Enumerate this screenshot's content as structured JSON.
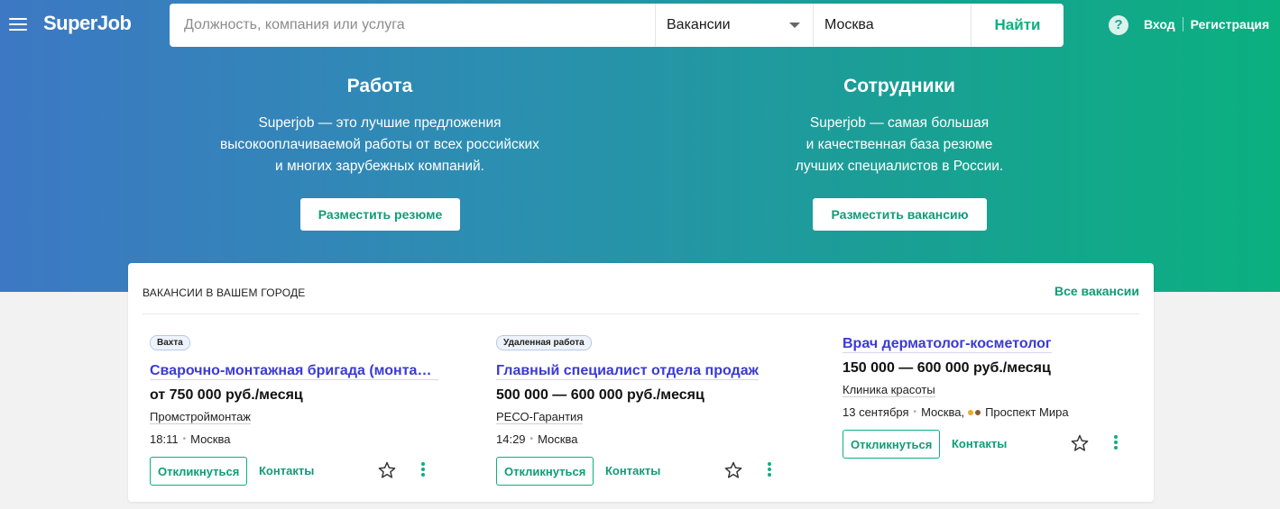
{
  "header": {
    "logo": "SuperJob",
    "search_placeholder": "Должность, компания или услуга",
    "type_select": "Вакансии",
    "city": "Москва",
    "find_button": "Найти",
    "help_icon": "?",
    "login": "Вход",
    "register": "Регистрация"
  },
  "hero": {
    "work": {
      "title": "Работа",
      "line1": "Superjob — это лучшие предложения",
      "line2": "высокооплачиваемой работы от всех российских",
      "line3": "и многих зарубежных компаний.",
      "button": "Разместить резюме"
    },
    "employees": {
      "title": "Сотрудники",
      "line1": "Superjob — самая большая",
      "line2": "и качественная база резюме",
      "line3": "лучших специалистов в России.",
      "button": "Разместить вакансию"
    }
  },
  "vacancies": {
    "heading": "ВАКАНСИИ В ВАШЕМ ГОРОДЕ",
    "all_link": "Все вакансии",
    "items": [
      {
        "badge": "Вахта",
        "title": "Сварочно-монтажная бригада (монтажн…",
        "salary": "от 750 000 руб./месяц",
        "company": "Промстроймонтаж",
        "time": "18:11",
        "city": "Москва",
        "respond": "Откликнуться",
        "contacts": "Контакты"
      },
      {
        "badge": "Удаленная работа",
        "title": "Главный специалист отдела продаж",
        "salary": "500 000 — 600 000 руб./месяц",
        "company": "РЕСО-Гарантия",
        "time": "14:29",
        "city": "Москва",
        "respond": "Откликнуться",
        "contacts": "Контакты"
      },
      {
        "title": "Врач дерматолог-косметолог",
        "salary": "150 000 — 600 000 руб./месяц",
        "company": "Клиника красоты",
        "time": "13 сентября",
        "city": "Москва,",
        "metro": "Проспект Мира",
        "metro_colors": [
          "#f5a623",
          "#8b5a2b"
        ],
        "respond": "Откликнуться",
        "contacts": "Контакты"
      }
    ]
  },
  "colors": {
    "brand_green": "#0bb07f",
    "link_blue": "#3a3ad6",
    "gradient_start": "#3d78c4",
    "gradient_end": "#0bb07f"
  }
}
